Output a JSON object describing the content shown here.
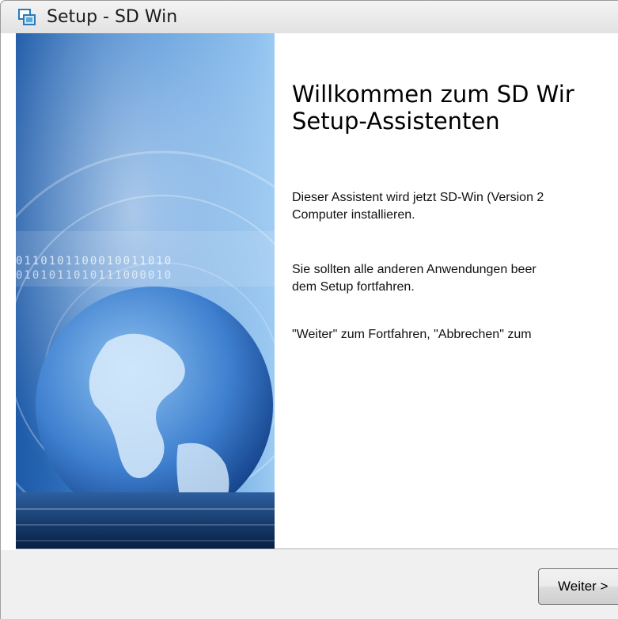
{
  "window": {
    "title": "Setup - SD Win",
    "icon": "setup-window-icon"
  },
  "wizard": {
    "heading_line1": "Willkommen zum SD Wir",
    "heading_line2": "Setup-Assistenten",
    "para1_line1": "Dieser Assistent wird jetzt SD-Win (Version 2",
    "para1_line2": "Computer installieren.",
    "para2_line1": "Sie sollten alle anderen Anwendungen beer",
    "para2_line2": "dem Setup fortfahren.",
    "para3_line1": "\"Weiter\" zum Fortfahren, \"Abbrechen\" zum",
    "binary_row1": "0110101100010011010",
    "binary_row2": "0101011010111000010"
  },
  "buttons": {
    "next_label": "Weiter >"
  },
  "colors": {
    "image_blue_light": "#7fb4e6",
    "image_blue_dark": "#0c3a7a",
    "footer_bg": "#f0f0f0"
  }
}
